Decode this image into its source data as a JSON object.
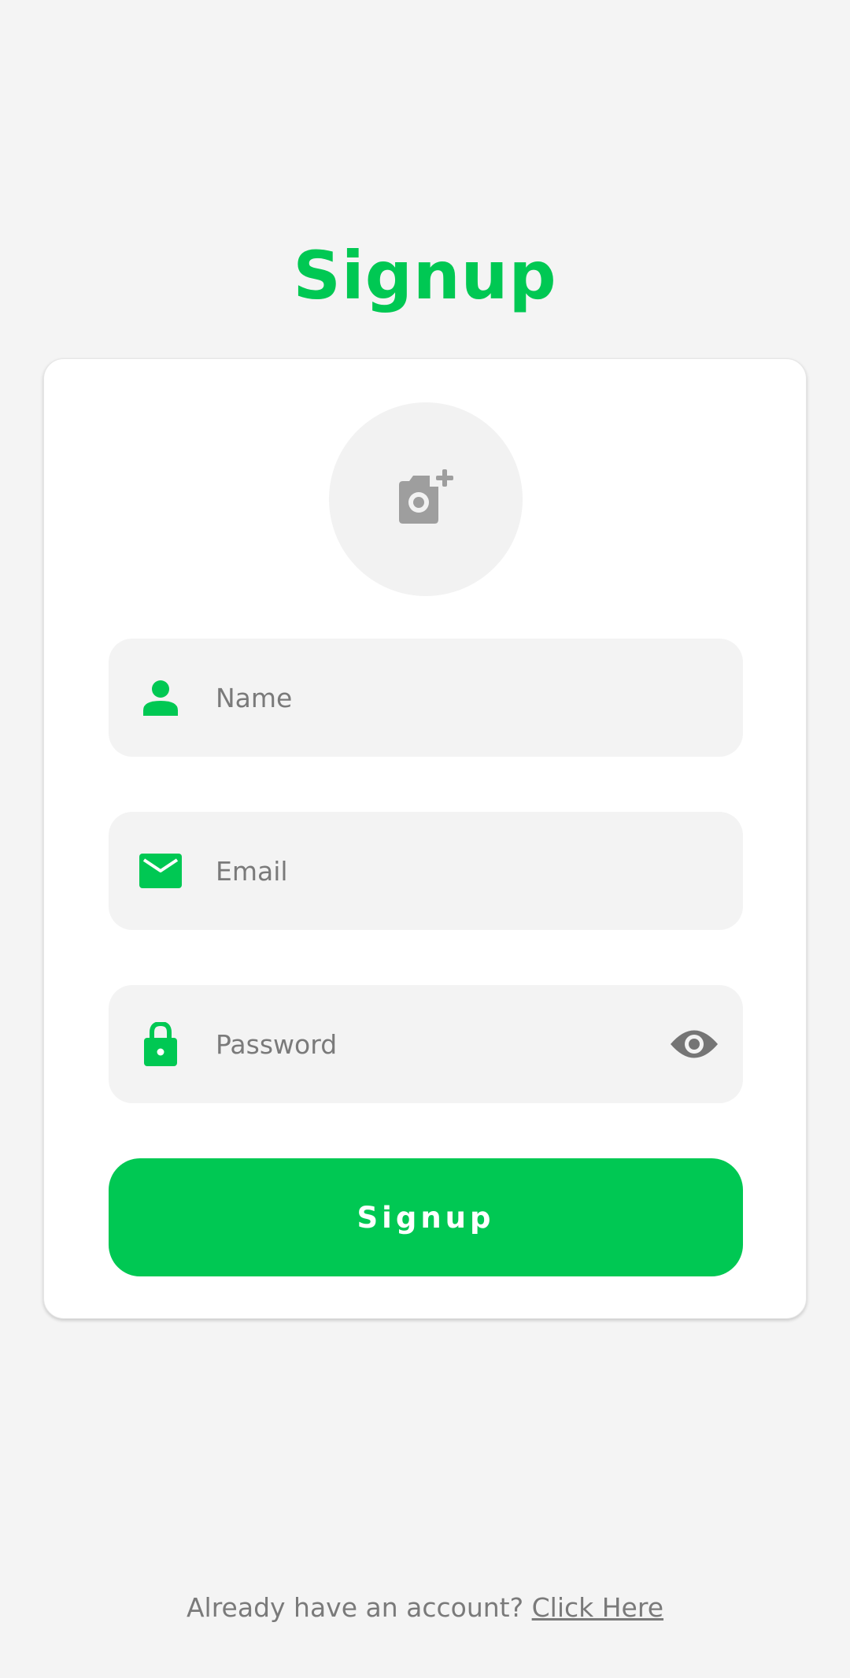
{
  "page": {
    "title": "Signup"
  },
  "avatar": {
    "icon": "add-photo-camera-icon"
  },
  "fields": {
    "name": {
      "placeholder": "Name",
      "value": "",
      "icon": "person-icon"
    },
    "email": {
      "placeholder": "Email",
      "value": "",
      "icon": "mail-icon"
    },
    "password": {
      "placeholder": "Password",
      "value": "",
      "icon": "lock-icon",
      "toggle_icon": "eye-icon"
    }
  },
  "submit": {
    "label": "Signup"
  },
  "footer": {
    "prompt": "Already have an account?",
    "link": "Click Here"
  },
  "colors": {
    "accent": "#00c853",
    "background": "#f4f4f4",
    "card": "#ffffff",
    "field": "#f3f3f3",
    "muted_text": "#7a7a7a",
    "icon_gray": "#9e9e9e"
  }
}
